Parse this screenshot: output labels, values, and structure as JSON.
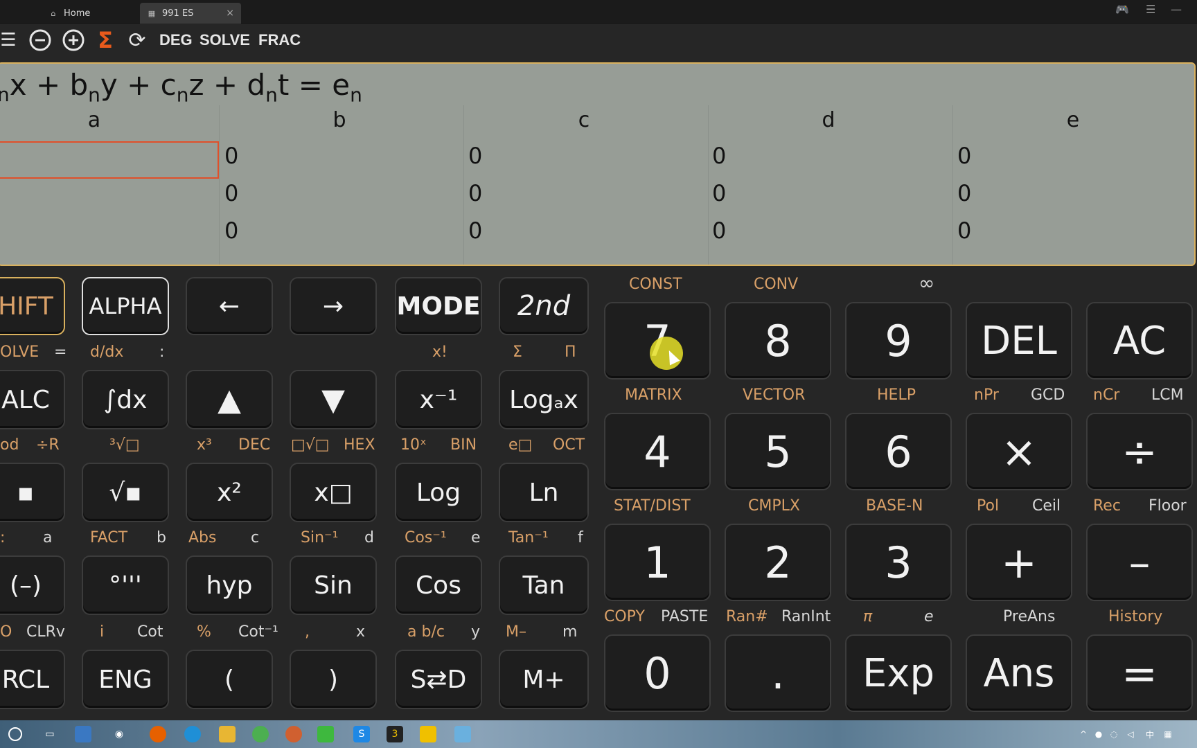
{
  "tabs": [
    {
      "label": "Home",
      "icon": "home-icon"
    },
    {
      "label": "991 ES",
      "icon": "calculator-icon",
      "close": "×"
    }
  ],
  "toolbar": {
    "items": [
      "DEG",
      "SOLVE",
      "FRAC"
    ],
    "sigma": "Σ"
  },
  "display": {
    "equation_parts": [
      "x + b",
      "n",
      "y + c",
      "n",
      "z + d",
      "n",
      "t = e",
      "n"
    ],
    "equation_prefix_sub": "n",
    "columns": [
      "a",
      "b",
      "c",
      "d",
      "e"
    ],
    "rows": [
      [
        "",
        "0",
        "0",
        "0",
        "0"
      ],
      [
        "",
        "0",
        "0",
        "0",
        "0"
      ],
      [
        "",
        "0",
        "0",
        "0",
        "0"
      ]
    ]
  },
  "keys_left": {
    "row1": [
      "HIFT",
      "ALPHA",
      "←",
      "→",
      "MODE",
      "2nd"
    ],
    "row1_labels": [
      "OLVE",
      "=",
      "d/dx",
      ":",
      "x!",
      "Σ",
      "Π"
    ],
    "row2": [
      "ALC",
      "∫dx",
      "▲",
      "▼",
      "x⁻¹",
      "Logₐx"
    ],
    "row2_labels": [
      "od",
      "÷R",
      "³√□",
      "x³",
      "DEC",
      "□√□",
      "HEX",
      "10ˣ",
      "BIN",
      "e□",
      "OCT"
    ],
    "row3": [
      "▪",
      "√▪",
      "x²",
      "x□",
      "Log",
      "Ln"
    ],
    "row3_labels": [
      ":",
      "a",
      "FACT",
      "b",
      "Abs",
      "c",
      "Sin⁻¹",
      "d",
      "Cos⁻¹",
      "e",
      "Tan⁻¹",
      "f"
    ],
    "row4": [
      "(–)",
      "°'''",
      "hyp",
      "Sin",
      "Cos",
      "Tan"
    ],
    "row4_labels": [
      "O",
      "CLRv",
      "i",
      "Cot",
      "%",
      "Cot⁻¹",
      ",",
      "x",
      "a b/c",
      "y",
      "M–",
      "m"
    ],
    "row5": [
      "RCL",
      "ENG",
      "(",
      ")",
      "S⇄D",
      "M+"
    ]
  },
  "keys_right": {
    "row1_labels": [
      "CONST",
      "CONV",
      "∞"
    ],
    "row1": [
      "7",
      "8",
      "9",
      "DEL",
      "AC"
    ],
    "row2_labels": [
      "MATRIX",
      "VECTOR",
      "HELP",
      "nPr",
      "GCD",
      "nCr",
      "LCM"
    ],
    "row2": [
      "4",
      "5",
      "6",
      "×",
      "÷"
    ],
    "row3_labels": [
      "STAT/DIST",
      "CMPLX",
      "BASE-N",
      "Pol",
      "Ceil",
      "Rec",
      "Floor"
    ],
    "row3": [
      "1",
      "2",
      "3",
      "+",
      "–"
    ],
    "row4_labels": [
      "COPY",
      "PASTE",
      "Ran#",
      "RanInt",
      "π",
      "e",
      "PreAns",
      "History"
    ],
    "row4": [
      "0",
      ".",
      "Exp",
      "Ans",
      "="
    ]
  },
  "colors": {
    "accent": "#e0502a",
    "lcd": "#979d96",
    "label": "#d9a068"
  }
}
